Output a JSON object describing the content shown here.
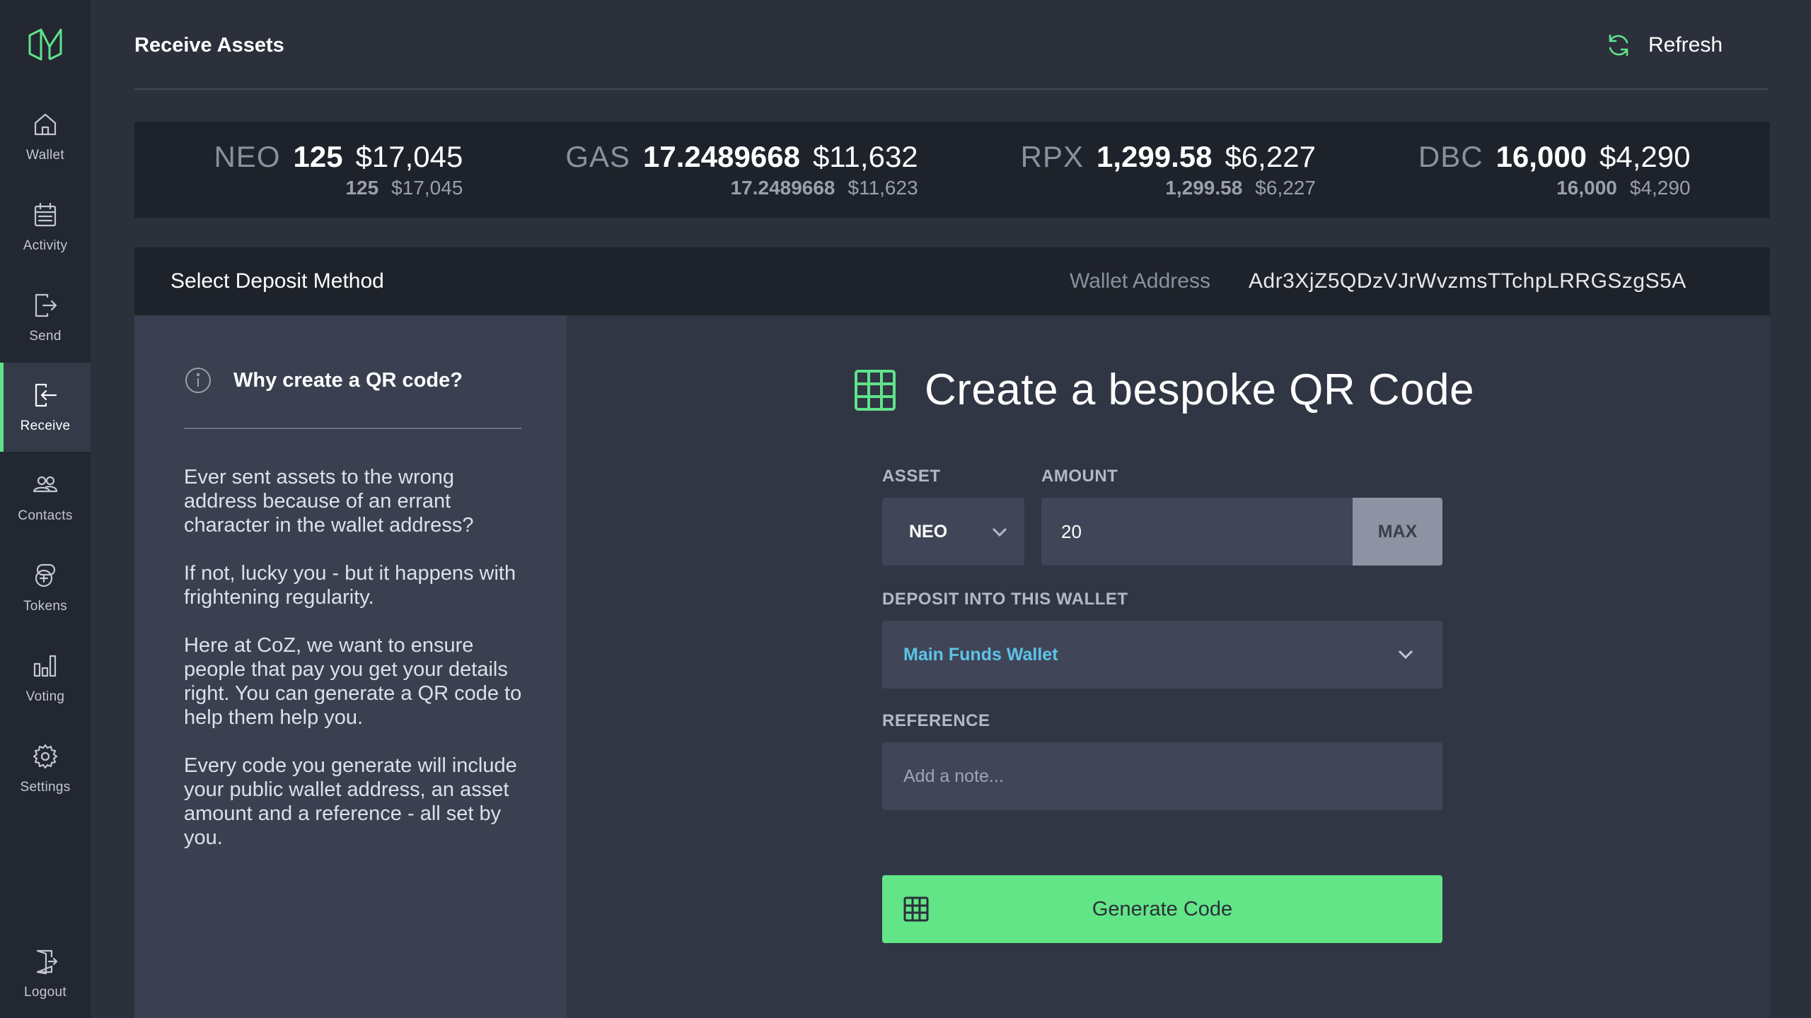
{
  "page": {
    "title": "Receive Assets",
    "refresh_label": "Refresh"
  },
  "colors": {
    "accent": "#5fe38a",
    "link": "#5cc4e8",
    "sidebar_bg": "#232731",
    "panel_bg": "#313644"
  },
  "sidebar": {
    "logo": "neon-logo-icon",
    "items": [
      {
        "label": "Wallet",
        "icon": "home-icon",
        "active": false
      },
      {
        "label": "Activity",
        "icon": "calendar-icon",
        "active": false
      },
      {
        "label": "Send",
        "icon": "send-icon",
        "active": false
      },
      {
        "label": "Receive",
        "icon": "receive-icon",
        "active": true
      },
      {
        "label": "Contacts",
        "icon": "contacts-icon",
        "active": false
      },
      {
        "label": "Tokens",
        "icon": "tokens-icon",
        "active": false
      },
      {
        "label": "Voting",
        "icon": "bar-chart-icon",
        "active": false
      },
      {
        "label": "Settings",
        "icon": "gear-icon",
        "active": false
      }
    ],
    "logout_label": "Logout"
  },
  "balances": [
    {
      "symbol": "NEO",
      "amount": "125",
      "usd": "$17,045",
      "sub_amount": "125",
      "sub_usd": "$17,045"
    },
    {
      "symbol": "GAS",
      "amount": "17.2489668",
      "usd": "$11,632",
      "sub_amount": "17.2489668",
      "sub_usd": "$11,623"
    },
    {
      "symbol": "RPX",
      "amount": "1,299.58",
      "usd": "$6,227",
      "sub_amount": "1,299.58",
      "sub_usd": "$6,227"
    },
    {
      "symbol": "DBC",
      "amount": "16,000",
      "usd": "$4,290",
      "sub_amount": "16,000",
      "sub_usd": "$4,290"
    }
  ],
  "deposit": {
    "title": "Select Deposit Method",
    "wallet_address_label": "Wallet Address",
    "wallet_address": "Adr3XjZ5QDzVJrWvzmsTTchpLRRGSzgS5A"
  },
  "info": {
    "heading": "Why create a QR code?",
    "paragraphs": [
      "Ever sent assets to the wrong address because of an errant character in the wallet address?",
      "If not, lucky you - but it happens with frightening regularity.",
      "Here at CoZ, we want to ensure people that pay you get your details right. You can generate a QR code to help them help you.",
      "Every code you generate will include your public wallet address, an asset amount and a reference - all set by you."
    ]
  },
  "form": {
    "heading": "Create a bespoke QR Code",
    "asset_label": "ASSET",
    "asset_value": "NEO",
    "amount_label": "AMOUNT",
    "amount_value": "20",
    "max_label": "MAX",
    "wallet_label": "DEPOSIT INTO THIS WALLET",
    "wallet_value": "Main Funds Wallet",
    "reference_label": "REFERENCE",
    "reference_placeholder": "Add a note...",
    "generate_label": "Generate Code"
  }
}
